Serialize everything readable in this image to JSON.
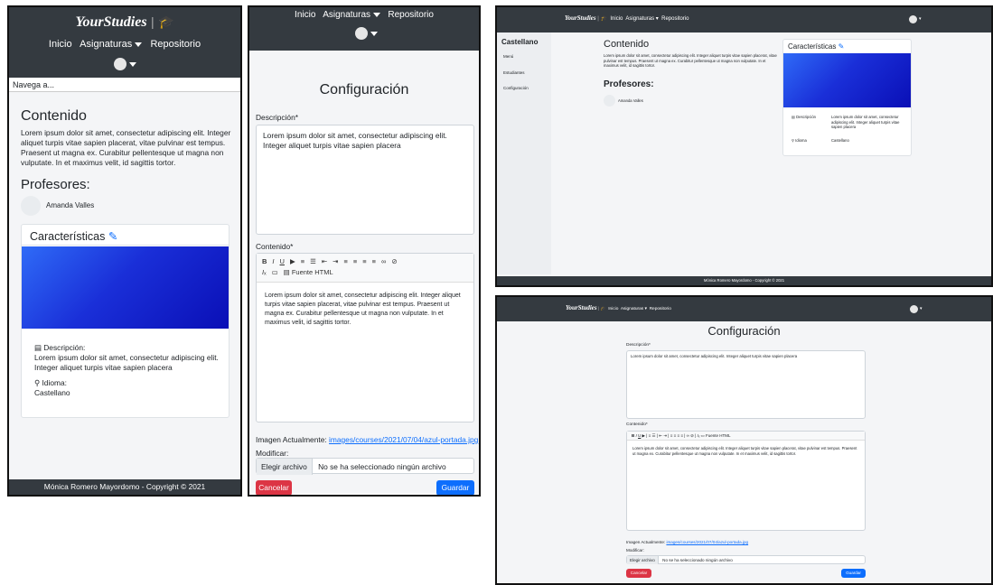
{
  "brand": {
    "name": "YourStudies",
    "cap_icon": "graduation-cap-icon"
  },
  "nav": {
    "inicio": "Inicio",
    "asignaturas": "Asignaturas",
    "repositorio": "Repositorio"
  },
  "search_placeholder": "Navega a...",
  "course": {
    "name": "Castellano",
    "sidebar": [
      "Menú",
      "Estudiantes",
      "Configuración"
    ],
    "section_title": "Contenido",
    "body": "Lorem ipsum dolor sit amet, consectetur adipiscing elit. Integer aliquet turpis vitae sapien placerat, vitae pulvinar est tempus. Praesent ut magna ex. Curabitur pellentesque ut magna non vulputate. In et maximus velit, id sagittis tortor.",
    "teachers_title": "Profesores:",
    "teacher": "Amanda Valles",
    "features_title": "Características",
    "desc_label": "Descripción:",
    "desc_value": "Lorem ipsum dolor sit amet, consectetur adipiscing elit. Integer aliquet turpis vitae sapien placera",
    "lang_label": "Idioma:",
    "lang_value": "Castellano",
    "desc_label_short": "Descripción",
    "lang_label_short": "Idioma"
  },
  "footer": "Mónica Romero Mayordomo - Copyright © 2021",
  "config": {
    "title": "Configuración",
    "desc_label": "Descripción*",
    "desc_value": "Lorem ipsum dolor sit amet, consectetur adipiscing elit. Integer aliquet turpis vitae sapien placera",
    "content_label": "Contenido*",
    "editor_text": "Lorem ipsum dolor sit amet, consectetur adipiscing elit. Integer aliquet turpis vitae sapien placerat, vitae pulvinar est tempus. Praesent ut magna ex. Curabitur pellentesque ut magna non vulputate. In et maximus velit, id sagittis tortor.",
    "source_label": "Fuente HTML",
    "image_label": "Imagen Actualmente:",
    "image_link": "images/courses/2021/07/04/azul-portada.jpg",
    "modify_label": "Modificar:",
    "file_button": "Elegir archivo",
    "file_none": "No se ha seleccionado ningún archivo",
    "cancel": "Cancelar",
    "save": "Guardar"
  },
  "colors": {
    "nav": "#343a40",
    "cancel": "#dc3545",
    "save": "#0d6efd",
    "cap": "#e0414f"
  }
}
